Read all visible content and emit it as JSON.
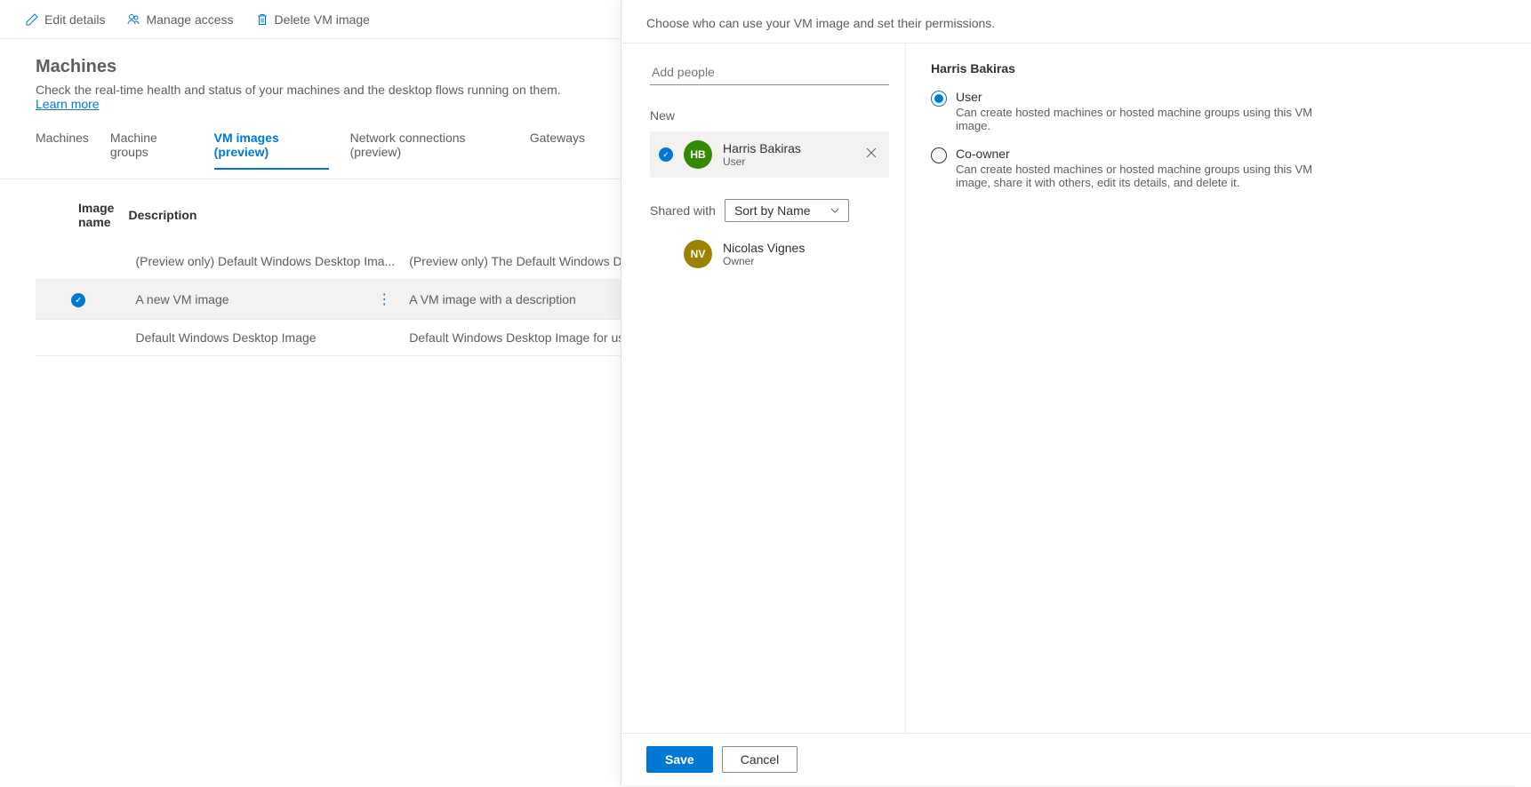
{
  "toolbar": {
    "edit_label": "Edit details",
    "manage_label": "Manage access",
    "delete_label": "Delete VM image"
  },
  "header": {
    "title": "Machines",
    "subtitle": "Check the real-time health and status of your machines and the desktop flows running on them. ",
    "learn_more": "Learn more"
  },
  "tabs": {
    "machines": "Machines",
    "groups": "Machine groups",
    "vm_images": "VM images (preview)",
    "network": "Network connections (preview)",
    "gateways": "Gateways"
  },
  "table": {
    "col_name": "Image name",
    "col_desc": "Description",
    "rows": [
      {
        "name": "(Preview only) Default Windows Desktop Ima...",
        "desc": "(Preview only) The Default Windows Desktop Image for use i...",
        "selected": false
      },
      {
        "name": "A new VM image",
        "desc": "A VM image with a description",
        "selected": true
      },
      {
        "name": "Default Windows Desktop Image",
        "desc": "Default Windows Desktop Image for use in Microsoft Deskto...",
        "selected": false
      }
    ]
  },
  "panel": {
    "header": "Choose who can use your VM image and set their permissions.",
    "add_placeholder": "Add people",
    "new_label": "New",
    "new_person": {
      "initials": "HB",
      "name": "Harris Bakiras",
      "role": "User"
    },
    "shared_with_label": "Shared with",
    "sort_label": "Sort by Name",
    "shared_people": [
      {
        "initials": "NV",
        "name": "Nicolas Vignes",
        "role": "Owner"
      }
    ],
    "detail_name": "Harris Bakiras",
    "permissions": {
      "user": {
        "label": "User",
        "desc": "Can create hosted machines or hosted machine groups using this VM image."
      },
      "coowner": {
        "label": "Co-owner",
        "desc": "Can create hosted machines or hosted machine groups using this VM image, share it with others, edit its details, and delete it."
      }
    },
    "save": "Save",
    "cancel": "Cancel"
  }
}
